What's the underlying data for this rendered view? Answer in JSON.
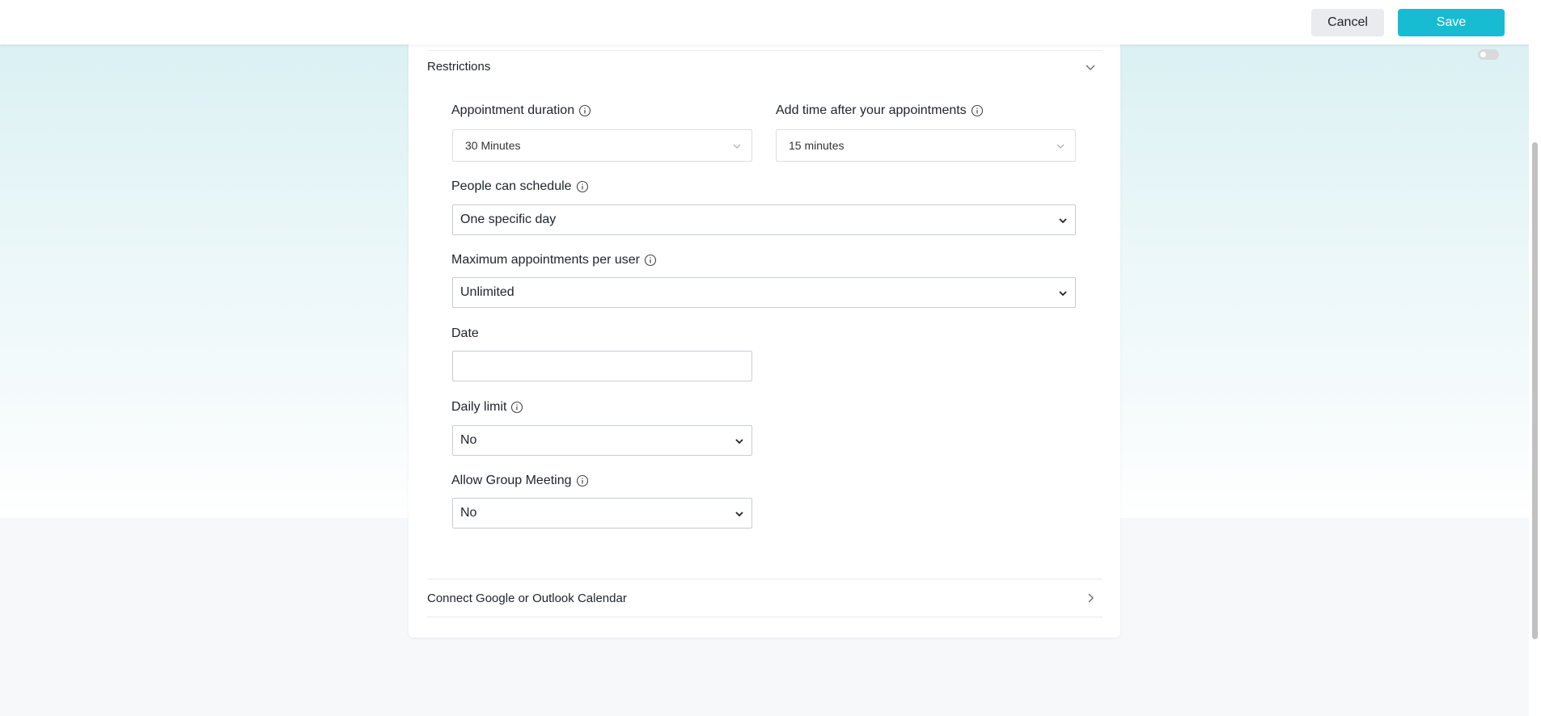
{
  "topbar": {
    "cancel_label": "Cancel",
    "save_label": "Save",
    "save_color": "#17bcd2"
  },
  "sections": {
    "restrictions_title": "Restrictions",
    "connect_calendar_title": "Connect Google or Outlook Calendar"
  },
  "form": {
    "appointment_duration": {
      "label": "Appointment duration",
      "value": "30 Minutes"
    },
    "add_time_after": {
      "label": "Add time after your appointments",
      "value": "15 minutes"
    },
    "people_can_schedule": {
      "label": "People can schedule",
      "value": "One specific day"
    },
    "max_appointments": {
      "label": "Maximum appointments per user",
      "value": "Unlimited"
    },
    "date": {
      "label": "Date",
      "value": ""
    },
    "daily_limit": {
      "label": "Daily limit",
      "value": "No"
    },
    "allow_group_meeting": {
      "label": "Allow Group Meeting",
      "value": "No"
    }
  },
  "icons": {
    "info": "info-circle-icon",
    "collapse": "chevron-down-icon",
    "expand": "chevron-right-icon"
  }
}
